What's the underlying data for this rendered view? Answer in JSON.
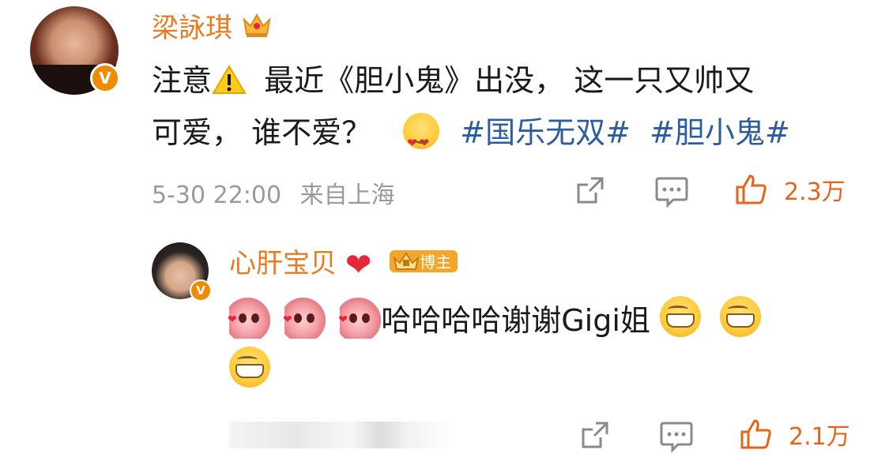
{
  "post": {
    "username": "梁詠琪",
    "content_prefix": "注意",
    "content_main": "最近《胆小鬼》出没， 这一只又帅又",
    "content_line2": "可爱， 谁不爱？",
    "hashtags": [
      "#国乐无双#",
      "#胆小鬼#"
    ],
    "timestamp": "5-30 22:00",
    "location": "来自上海",
    "like_count": "2.3万",
    "verified_badge": "V"
  },
  "reply": {
    "username": "心肝宝贝",
    "badge_label": "博主",
    "content_text": "哈哈哈哈谢谢Gigi姐",
    "like_count": "2.1万",
    "verified_badge": "V"
  },
  "colors": {
    "username": "#ea7a1f",
    "hashtag": "#2e5d9f",
    "meta": "#9a9a9a",
    "like": "#e8631a"
  },
  "icons": [
    "crown-icon",
    "warning-icon",
    "heart-eyes-emoji",
    "share-icon",
    "comment-icon",
    "thumbs-up-icon",
    "red-heart-icon",
    "crown-badge-icon",
    "sticker-emoji",
    "grin-emoji"
  ]
}
